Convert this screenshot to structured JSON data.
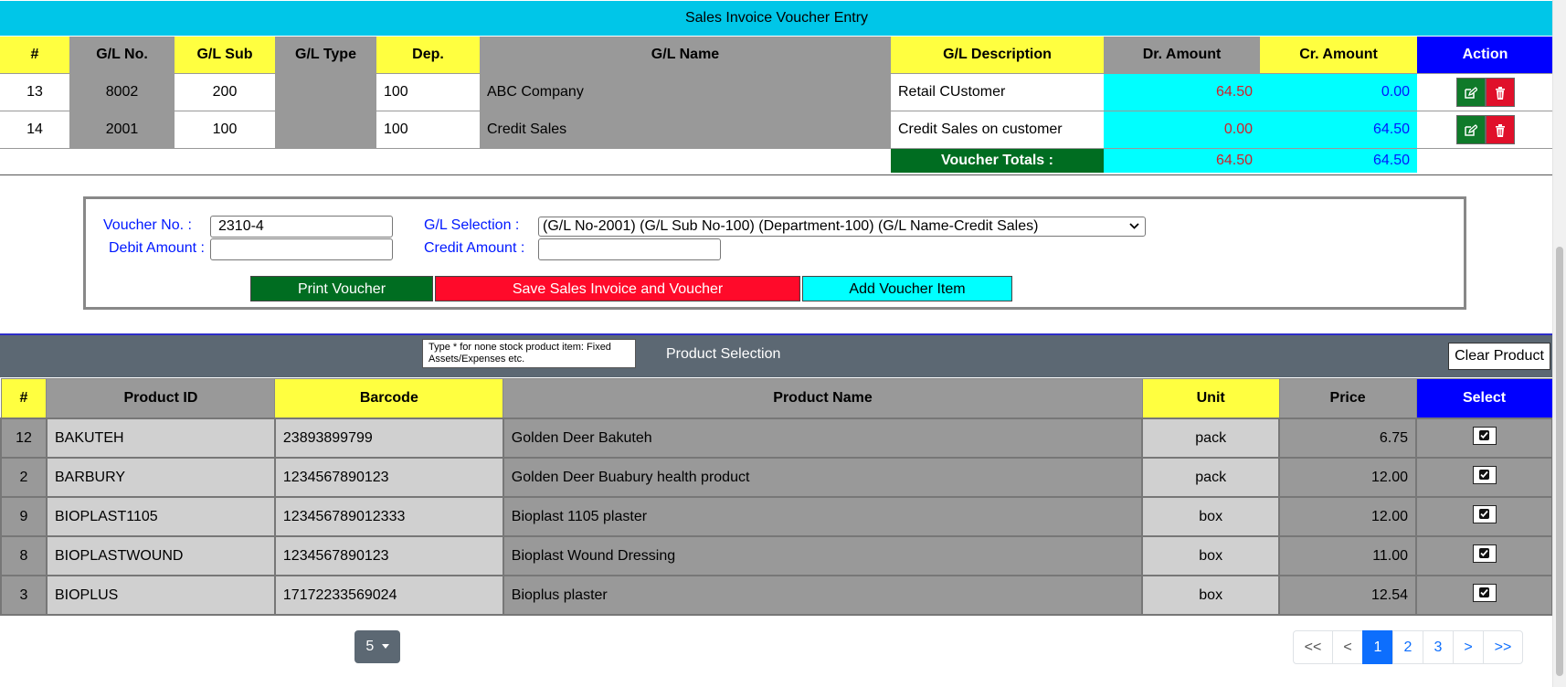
{
  "voucher_header": {
    "title": "Sales Invoice Voucher Entry"
  },
  "gl_table": {
    "columns": [
      "#",
      "G/L No.",
      "G/L Sub",
      "G/L Type",
      "Dep.",
      "G/L Name",
      "G/L Description",
      "Dr. Amount",
      "Cr. Amount",
      "Action"
    ],
    "rows": [
      {
        "num": "13",
        "gl_no": "8002",
        "gl_sub": "200",
        "gl_type": "",
        "dep": "100",
        "gl_name": "ABC Company",
        "description": "Retail CUstomer",
        "dr": "64.50",
        "cr": "0.00"
      },
      {
        "num": "14",
        "gl_no": "2001",
        "gl_sub": "100",
        "gl_type": "",
        "dep": "100",
        "gl_name": "Credit Sales",
        "description": "Credit Sales on customer",
        "dr": "0.00",
        "cr": "64.50"
      }
    ],
    "totals": {
      "label": "Voucher Totals :",
      "dr": "64.50",
      "cr": "64.50"
    }
  },
  "voucher_form": {
    "voucher_no_label": "Voucher No. :",
    "voucher_no_value": "2310-4",
    "gl_selection_label": "G/L Selection :",
    "gl_selection_value": "(G/L No-2001) (G/L Sub No-100) (Department-100) (G/L Name-Credit Sales)",
    "debit_label": "Debit Amount :",
    "debit_value": "",
    "credit_label": "Credit Amount :",
    "credit_value": "",
    "print_label": "Print Voucher",
    "save_label": "Save Sales Invoice and Voucher",
    "add_label": "Add Voucher Item"
  },
  "product_selection": {
    "tooltip": "Type * for none stock product item: Fixed Assets/Expenses etc.",
    "title": "Product Selection",
    "clear_label": "Clear Product"
  },
  "product_table": {
    "columns": [
      "#",
      "Product ID",
      "Barcode",
      "Product Name",
      "Unit",
      "Price",
      "Select"
    ],
    "rows": [
      {
        "num": "12",
        "product_id": "BAKUTEH",
        "barcode": "23893899799",
        "name": "Golden Deer Bakuteh",
        "unit": "pack",
        "price": "6.75"
      },
      {
        "num": "2",
        "product_id": "BARBURY",
        "barcode": "1234567890123",
        "name": "Golden Deer Buabury health product",
        "unit": "pack",
        "price": "12.00"
      },
      {
        "num": "9",
        "product_id": "BIOPLAST1105",
        "barcode": "123456789012333",
        "name": "Bioplast 1105 plaster",
        "unit": "box",
        "price": "12.00"
      },
      {
        "num": "8",
        "product_id": "BIOPLASTWOUND",
        "barcode": "1234567890123",
        "name": "Bioplast Wound Dressing",
        "unit": "box",
        "price": "11.00"
      },
      {
        "num": "3",
        "product_id": "BIOPLUS",
        "barcode": "17172233569024",
        "name": "Bioplus plaster",
        "unit": "box",
        "price": "12.54"
      }
    ]
  },
  "pagination": {
    "page_size": "5",
    "buttons": [
      "<<",
      "<",
      "1",
      "2",
      "3",
      ">",
      ">>"
    ],
    "active": "1"
  },
  "colors": {
    "header_cyan": "#00c6e8",
    "header_yellow": "#ffff40",
    "header_gray": "#999999",
    "action_blue": "#0000ff",
    "amount_cyan": "#00ffff",
    "debit_red": "#d0202a",
    "credit_blue": "#0018ff",
    "totals_green": "#006d21",
    "print_green": "#006d21",
    "save_red": "#ff0a2a",
    "add_cyan": "#00ffff",
    "product_bar": "#5c6873",
    "page_active": "#0d6efd"
  },
  "icons": {
    "edit": "edit-icon",
    "delete": "trash-icon",
    "select": "check-square-icon",
    "dropdown": "chevron-down-icon"
  }
}
